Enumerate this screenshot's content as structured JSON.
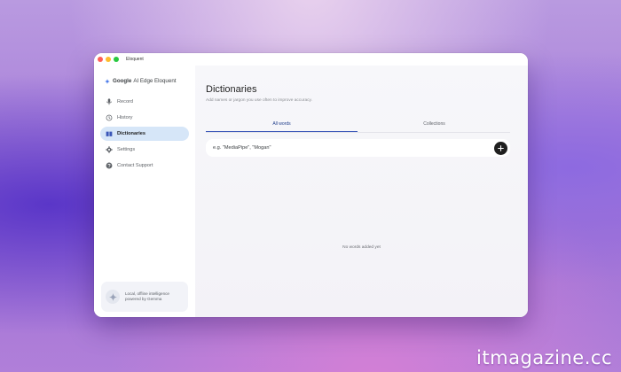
{
  "window": {
    "title": "Eloquent"
  },
  "sidebar": {
    "brand_google": "Google",
    "brand_rest": "AI Edge Eloquent",
    "items": [
      {
        "label": "Record",
        "icon": "mic-icon"
      },
      {
        "label": "History",
        "icon": "history-icon"
      },
      {
        "label": "Dictionaries",
        "icon": "book-icon",
        "active": true
      },
      {
        "label": "Settings",
        "icon": "gear-icon"
      },
      {
        "label": "Contact Support",
        "icon": "help-icon"
      }
    ],
    "promo": {
      "line1": "Local, offline intelligence",
      "line2": "powered by Gemma"
    }
  },
  "main": {
    "title": "Dictionaries",
    "subtitle": "Add names or jargon you use often to improve accuracy.",
    "tabs": [
      {
        "label": "All words",
        "active": true
      },
      {
        "label": "Collections",
        "active": false
      }
    ],
    "input_placeholder": "e.g. \"MediaPipe\", \"Mogan\"",
    "empty_message": "No words added yet"
  },
  "watermark": "itmagazine.cc",
  "colors": {
    "active_nav_bg": "#d6e6f8",
    "tab_accent": "#3a56b8",
    "add_button": "#1f1f1f"
  }
}
